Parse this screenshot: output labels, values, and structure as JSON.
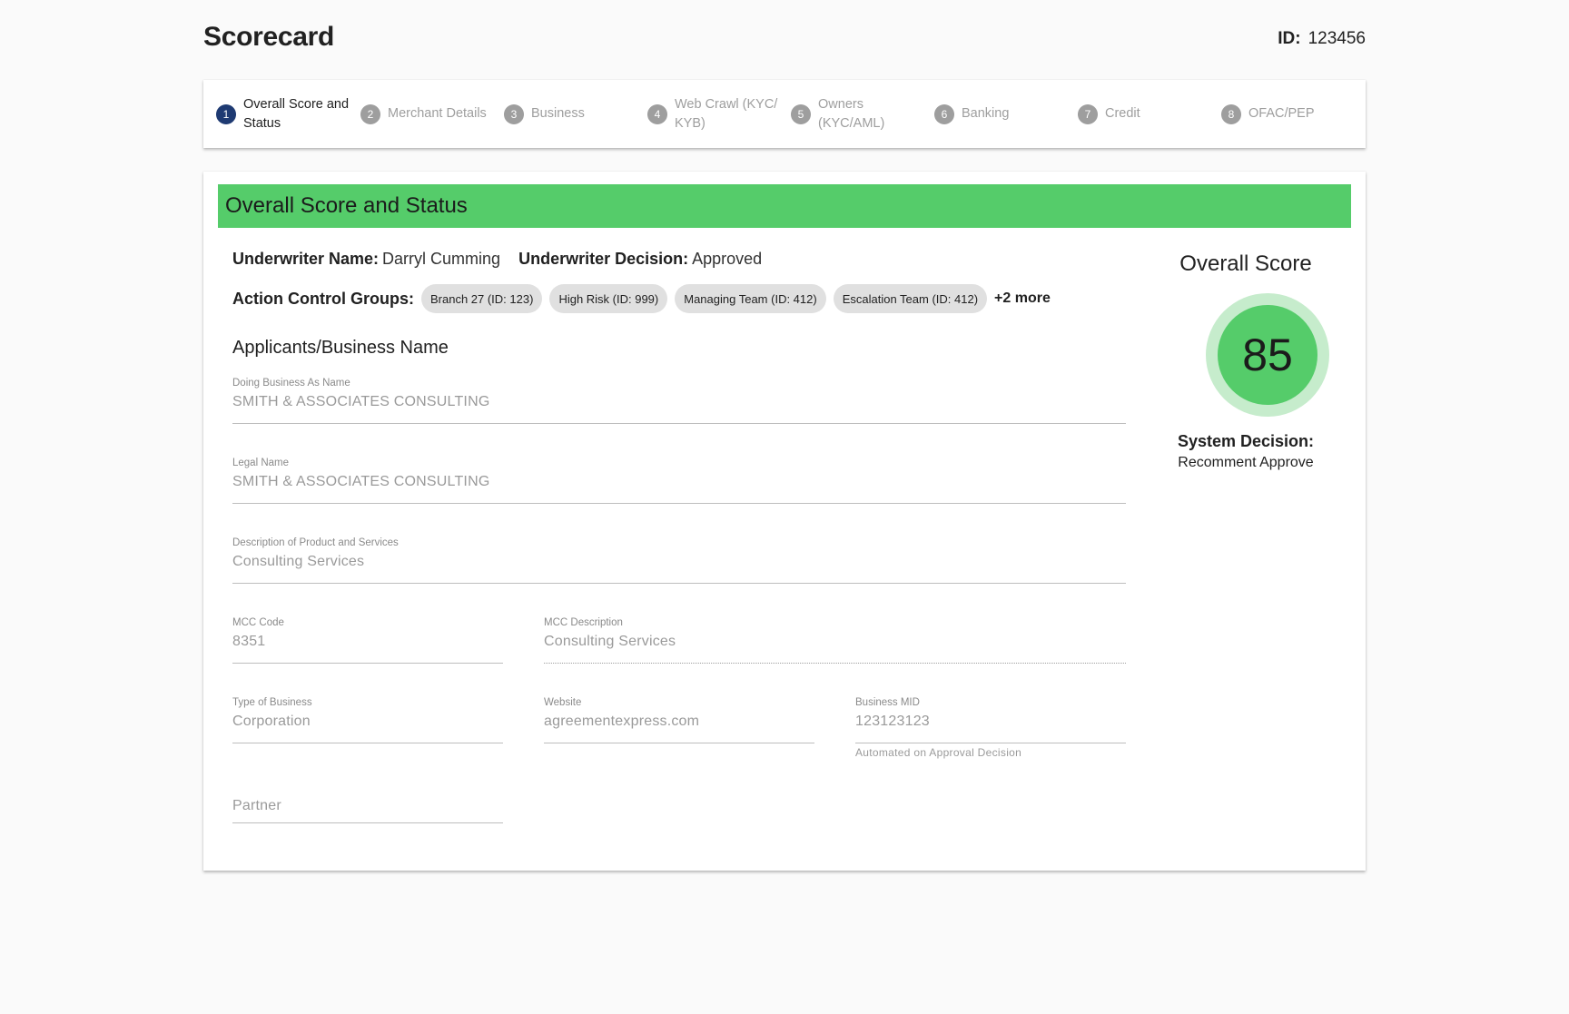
{
  "header": {
    "title": "Scorecard",
    "id_label": "ID:",
    "id_value": "123456"
  },
  "stepper": {
    "steps": [
      {
        "num": "1",
        "label": "Overall Score and Status",
        "active": true
      },
      {
        "num": "2",
        "label": "Merchant Details"
      },
      {
        "num": "3",
        "label": "Business"
      },
      {
        "num": "4",
        "label": "Web Crawl (KYC/ KYB)"
      },
      {
        "num": "5",
        "label": "Owners (KYC/AML)"
      },
      {
        "num": "6",
        "label": "Banking"
      },
      {
        "num": "7",
        "label": "Credit"
      },
      {
        "num": "8",
        "label": "OFAC/PEP"
      }
    ]
  },
  "card": {
    "banner_title": "Overall Score and Status",
    "underwriter_name_label": "Underwriter Name:",
    "underwriter_name": "Darryl Cumming",
    "underwriter_decision_label": "Underwriter Decision:",
    "underwriter_decision": "Approved",
    "action_groups_label": "Action Control Groups:",
    "action_groups": [
      "Branch 27 (ID: 123)",
      "High Risk (ID: 999)",
      "Managing Team (ID: 412)",
      "Escalation Team (ID: 412)"
    ],
    "action_groups_more": "+2 more",
    "section_title": "Applicants/Business Name",
    "fields": {
      "dba": {
        "label": "Doing Business As Name",
        "value": "SMITH & ASSOCIATES CONSULTING"
      },
      "legal": {
        "label": "Legal Name",
        "value": "SMITH & ASSOCIATES CONSULTING"
      },
      "description": {
        "label": "Description of Product and Services",
        "value": "Consulting Services"
      },
      "mcc_code": {
        "label": "MCC Code",
        "value": "8351"
      },
      "mcc_description": {
        "label": "MCC Description",
        "value": "Consulting Services"
      },
      "type_of_business": {
        "label": "Type of Business",
        "value": "Corporation"
      },
      "website": {
        "label": "Website",
        "value": "agreementexpress.com"
      },
      "business_mid": {
        "label": "Business MID",
        "value": "123123123",
        "helper": "Automated on Approval Decision"
      },
      "partner": {
        "placeholder": "Partner"
      }
    },
    "score": {
      "title": "Overall Score",
      "value": "85",
      "system_decision_label": "System Decision:",
      "system_decision": "Recomment Approve"
    }
  },
  "colors": {
    "accent_green": "#55cc6a",
    "score_ring": "#c6eccc",
    "active_step": "#1e3a72",
    "inactive_step": "#9e9e9e"
  }
}
